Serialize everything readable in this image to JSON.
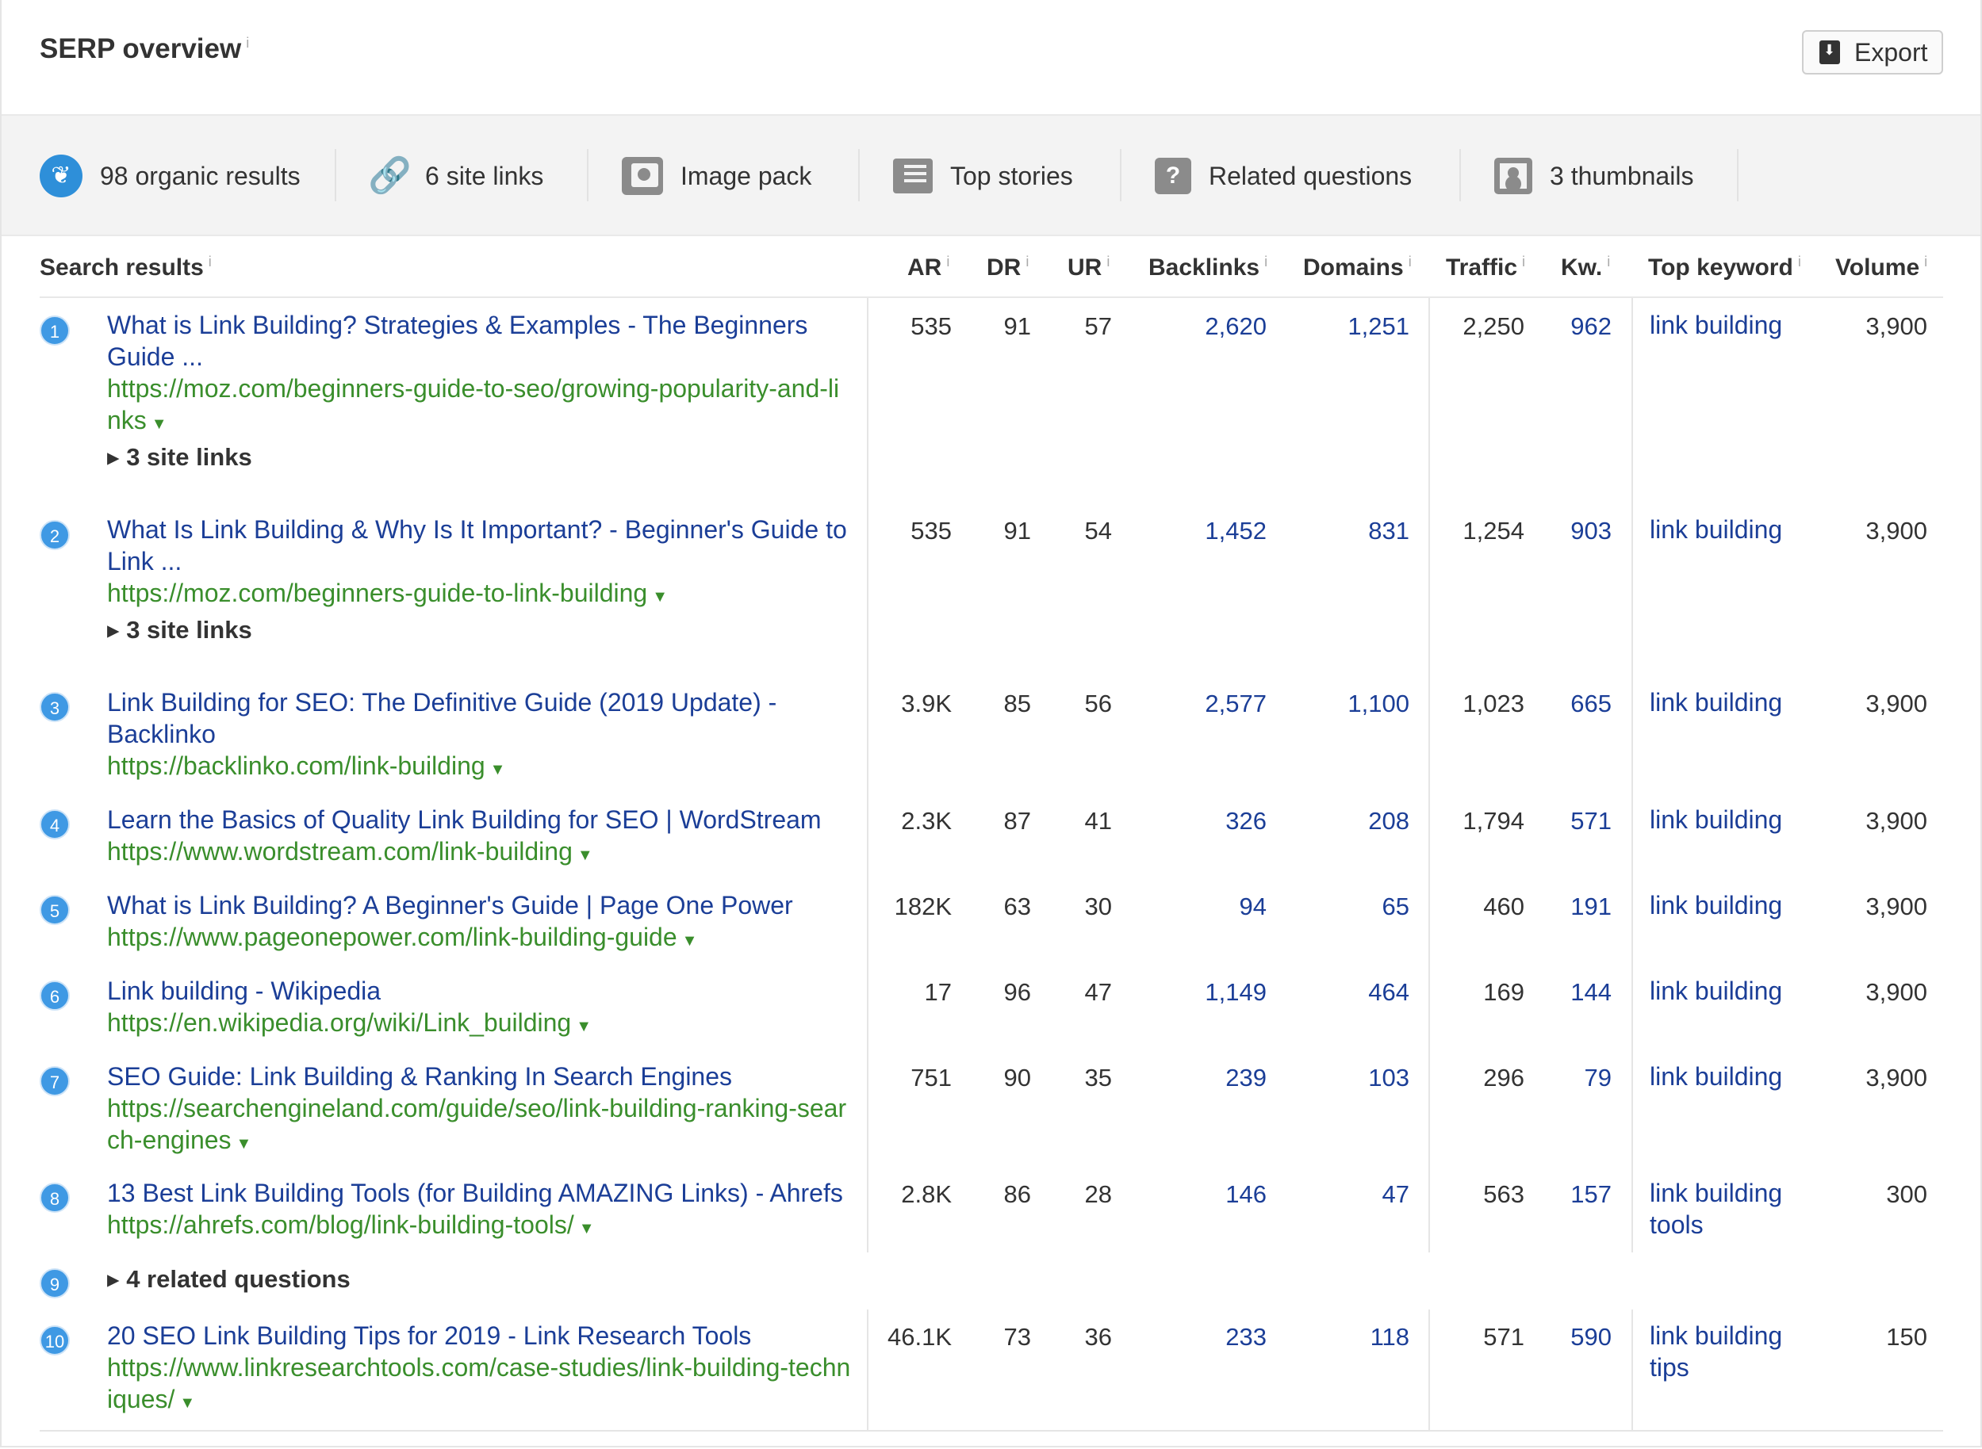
{
  "header": {
    "title": "SERP overview",
    "info_glyph": "i",
    "export_label": "Export"
  },
  "features": [
    {
      "label": "98 organic results",
      "icon": "leaf-icon"
    },
    {
      "label": "6 site links",
      "icon": "link-icon"
    },
    {
      "label": "Image pack",
      "icon": "image-pack-icon"
    },
    {
      "label": "Top stories",
      "icon": "newspaper-icon"
    },
    {
      "label": "Related questions",
      "icon": "question-icon"
    },
    {
      "label": "3 thumbnails",
      "icon": "thumbnail-icon"
    }
  ],
  "columns": {
    "search_results": "Search results",
    "ar": "AR",
    "dr": "DR",
    "ur": "UR",
    "backlinks": "Backlinks",
    "domains": "Domains",
    "traffic": "Traffic",
    "kw": "Kw.",
    "top_keyword": "Top keyword",
    "volume": "Volume"
  },
  "results": [
    {
      "pos": "1",
      "title": "What is Link Building? Strategies & Examples - The Beginners Guide ...",
      "url": "https://moz.com/beginners-guide-to-seo/growing-popularity-and-links",
      "sitelinks": "3 site links",
      "ar": "535",
      "dr": "91",
      "ur": "57",
      "backlinks": "2,620",
      "domains": "1,251",
      "traffic": "2,250",
      "kw": "962",
      "top_keyword": "link building",
      "volume": "3,900"
    },
    {
      "pos": "2",
      "title": "What Is Link Building & Why Is It Important? - Beginner's Guide to Link ...",
      "url": "https://moz.com/beginners-guide-to-link-building",
      "sitelinks": "3 site links",
      "ar": "535",
      "dr": "91",
      "ur": "54",
      "backlinks": "1,452",
      "domains": "831",
      "traffic": "1,254",
      "kw": "903",
      "top_keyword": "link building",
      "volume": "3,900"
    },
    {
      "pos": "3",
      "title": "Link Building for SEO: The Definitive Guide (2019 Update) - Backlinko",
      "url": "https://backlinko.com/link-building",
      "ar": "3.9K",
      "dr": "85",
      "ur": "56",
      "backlinks": "2,577",
      "domains": "1,100",
      "traffic": "1,023",
      "kw": "665",
      "top_keyword": "link building",
      "volume": "3,900"
    },
    {
      "pos": "4",
      "title": "Learn the Basics of Quality Link Building for SEO | WordStream",
      "url": "https://www.wordstream.com/link-building",
      "ar": "2.3K",
      "dr": "87",
      "ur": "41",
      "backlinks": "326",
      "domains": "208",
      "traffic": "1,794",
      "kw": "571",
      "top_keyword": "link building",
      "volume": "3,900"
    },
    {
      "pos": "5",
      "title": "What is Link Building? A Beginner's Guide | Page One Power",
      "url": "https://www.pageonepower.com/link-building-guide",
      "ar": "182K",
      "dr": "63",
      "ur": "30",
      "backlinks": "94",
      "domains": "65",
      "traffic": "460",
      "kw": "191",
      "top_keyword": "link building",
      "volume": "3,900"
    },
    {
      "pos": "6",
      "title": "Link building - Wikipedia",
      "url": "https://en.wikipedia.org/wiki/Link_building",
      "ar": "17",
      "dr": "96",
      "ur": "47",
      "backlinks": "1,149",
      "domains": "464",
      "traffic": "169",
      "kw": "144",
      "top_keyword": "link building",
      "volume": "3,900"
    },
    {
      "pos": "7",
      "title": "SEO Guide: Link Building & Ranking In Search Engines",
      "url": "https://searchengineland.com/guide/seo/link-building-ranking-search-engines",
      "ar": "751",
      "dr": "90",
      "ur": "35",
      "backlinks": "239",
      "domains": "103",
      "traffic": "296",
      "kw": "79",
      "top_keyword": "link building",
      "volume": "3,900"
    },
    {
      "pos": "8",
      "title": "13 Best Link Building Tools (for Building AMAZING Links) - Ahrefs",
      "url": "https://ahrefs.com/blog/link-building-tools/",
      "ar": "2.8K",
      "dr": "86",
      "ur": "28",
      "backlinks": "146",
      "domains": "47",
      "traffic": "563",
      "kw": "157",
      "top_keyword": "link building tools",
      "volume": "300"
    },
    {
      "pos": "10",
      "title": "20 SEO Link Building Tips for 2019 - Link Research Tools",
      "url": "https://www.linkresearchtools.com/case-studies/link-building-techniques/",
      "ar": "46.1K",
      "dr": "73",
      "ur": "36",
      "backlinks": "233",
      "domains": "118",
      "traffic": "571",
      "kw": "590",
      "top_keyword": "link building tips",
      "volume": "150"
    }
  ],
  "related": {
    "pos": "9",
    "label": "4 related questions"
  }
}
